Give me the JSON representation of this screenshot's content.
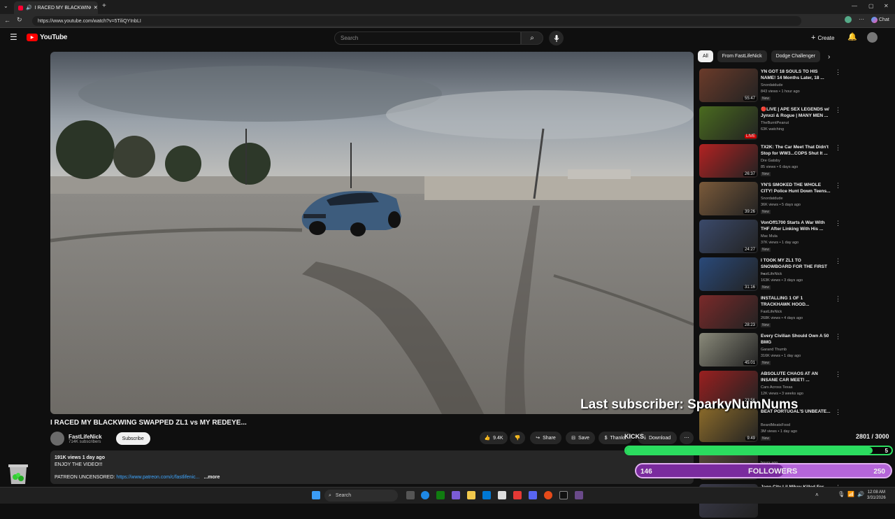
{
  "browser": {
    "tab_title": "I RACED MY BLACKWING SWAP",
    "url": "https://www.youtube.com/watch?v=5TiliQYInbLI",
    "chat_label": "Chat"
  },
  "header": {
    "logo_text": "YouTube",
    "search_placeholder": "Search",
    "create_label": "Create"
  },
  "video": {
    "title": "I RACED MY BLACKWING SWAPPED ZL1 vs MY REDEYE...",
    "channel_name": "FastLifeNick",
    "subscribers": "714K subscribers",
    "subscribe_label": "Subscribe",
    "likes": "9.4K",
    "share_label": "Share",
    "save_label": "Save",
    "thanks_label": "Thanks",
    "download_label": "Download",
    "views_date": "191K views  1 day ago",
    "desc_line1": "ENJOY THE VIDEO!!!",
    "patreon_label": "PATREON UNCENSORED: ",
    "patreon_link": "https://www.patreon.com/c/fastlifenic...",
    "more_label": "...more"
  },
  "chips": [
    "All",
    "From FastLifeNick",
    "Dodge Challenger"
  ],
  "recommendations": [
    {
      "title": "YN GOT 18 SOULS TO HIS NAME! 14 Months Later, 18 ...",
      "channel": "Snordatdude",
      "meta": "843 views • 1 hour ago",
      "duration": "55:47",
      "badge": "New",
      "color": "#6b3b2a"
    },
    {
      "title": "🔴LIVE | APE SEX LEGENDS w/ Jynxzi & Rogue | MANY MEN ...",
      "channel": "TheBurntPeanut",
      "meta": "63K watching",
      "duration": "LIVE",
      "badge": "",
      "color": "#4a6b1f"
    },
    {
      "title": "TX2K: The Car Meet That Didn't Stop for WW3...COPS Shut It ...",
      "channel": "Dre Gatsby",
      "meta": "85 views • 6 days ago",
      "duration": "26:37",
      "badge": "New",
      "color": "#b22222"
    },
    {
      "title": "YN'S SMOKED THE WHOLE CITY! Police Hunt Down Teens...",
      "channel": "Snordatdude",
      "meta": "36K views • 5 days ago",
      "duration": "39:26",
      "badge": "New",
      "color": "#7a5a3a"
    },
    {
      "title": "VonOff1700 Starts A War With THF After Linking With His ...",
      "channel": "Mac Mula",
      "meta": "37K views • 1 day ago",
      "duration": "24:27",
      "badge": "New",
      "color": "#3b4a6b"
    },
    {
      "title": "I TOOK MY ZL1 TO SNOWBOARD FOR THE FIRST ...",
      "channel": "FastLifeNick",
      "meta": "163K views • 3 days ago",
      "duration": "31:16",
      "badge": "New",
      "color": "#2a4a7a"
    },
    {
      "title": "INSTALLING 1 OF 1 TRACKHAWK HOOD...",
      "channel": "FastLifeNick",
      "meta": "268K views • 4 days ago",
      "duration": "28:23",
      "badge": "New",
      "color": "#7a2a2a"
    },
    {
      "title": "Every Civilian Should Own A 50 BMG",
      "channel": "Garand Thumb",
      "meta": "316K views • 1 day ago",
      "duration": "45:01",
      "badge": "New",
      "color": "#8a8a7a"
    },
    {
      "title": "ABSOLUTE CHAOS AT AN INSANE CAR MEET! ...",
      "channel": "Cars Across Texas",
      "meta": "12K views • 3 weeks ago",
      "duration": "23:56",
      "badge": "",
      "color": "#9a2020"
    },
    {
      "title": "BEAT PORTUGAL'S UNBEATE...",
      "channel": "BeardMeatsFood",
      "meta": "3M views • 1 day ago",
      "duration": "9:49",
      "badge": "New",
      "color": "#8a6a2a"
    },
    {
      "title": "",
      "channel": "",
      "meta": "hours ago",
      "duration": "",
      "badge": "",
      "color": "#5a4a3a"
    },
    {
      "title": "Jaqo City Lil Mikey Killed For ...",
      "channel": "",
      "meta": "",
      "duration": "",
      "badge": "",
      "color": "#3a3a4a"
    }
  ],
  "overlay": {
    "last_subscriber": "Last subscriber: SparkyNumNums",
    "kicks_label": "KICKS",
    "kicks_count": "2801 / 3000",
    "kicks_value": "5",
    "kicks_progress": 0.93,
    "followers_current": "146",
    "followers_label": "FOLLOWERS",
    "followers_goal": "250",
    "followers_progress": 0.58
  },
  "taskbar": {
    "search_label": "Search",
    "time": "12:08 AM",
    "date": "3/31/2026"
  }
}
